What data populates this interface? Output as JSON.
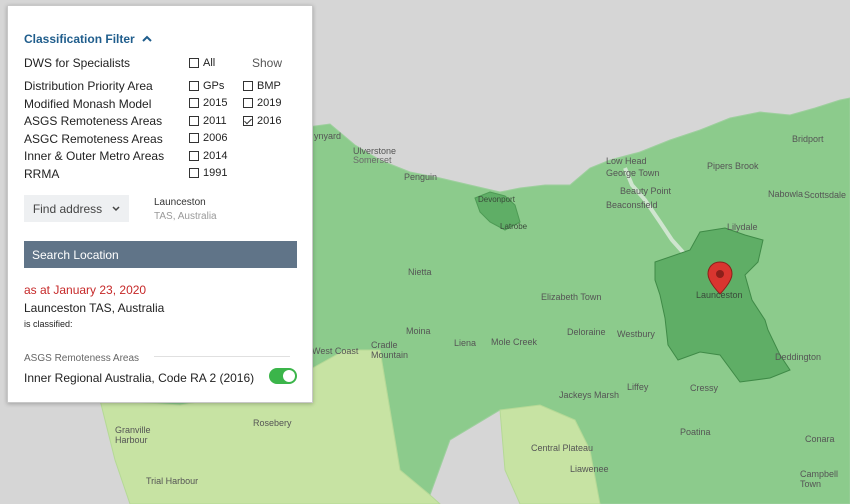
{
  "panel": {
    "title": "Classification Filter",
    "show_label": "Show",
    "filters": [
      {
        "label": "DWS for Specialists"
      },
      {
        "label": "Distribution Priority Area"
      },
      {
        "label": "Modified Monash Model"
      },
      {
        "label": "ASGS Remoteness Areas"
      },
      {
        "label": "ASGC Remoteness Areas"
      },
      {
        "label": "Inner & Outer Metro Areas"
      },
      {
        "label": "RRMA"
      }
    ],
    "checkboxes_left": [
      {
        "label": "All",
        "checked": false
      },
      {
        "label": "GPs",
        "checked": false
      },
      {
        "label": "2015",
        "checked": false
      },
      {
        "label": "2011",
        "checked": false
      },
      {
        "label": "2006",
        "checked": false
      },
      {
        "label": "2014",
        "checked": false
      },
      {
        "label": "1991",
        "checked": false
      }
    ],
    "checkboxes_right": [
      {
        "label": "BMP",
        "checked": false
      },
      {
        "label": "2019",
        "checked": false
      },
      {
        "label": "2016",
        "checked": true
      }
    ],
    "find_address_label": "Find address",
    "address_name": "Launceston",
    "address_sub": "TAS, Australia",
    "search_button": "Search Location",
    "as_at": "as at January 23, 2020",
    "location": "Launceston TAS, Australia",
    "classified_text": "is classified:",
    "section_label": "ASGS Remoteness Areas",
    "result": "Inner Regional Australia, Code RA 2 (2016)",
    "result_toggle_on": true
  },
  "map": {
    "labels": {
      "ynyard": "ynyard",
      "ulverstone": "Ulverstone",
      "somerset": "Somerset",
      "penguin": "Penguin",
      "devonport": "Devonport",
      "latrobe": "Latrobe",
      "low_head": "Low Head",
      "george_town": "George Town",
      "beauty_point": "Beauty Point",
      "beaconsfield": "Beaconsfield",
      "pipers_brook": "Pipers Brook",
      "bridport": "Bridport",
      "nabowla": "Nabowla",
      "scottsdale": "Scottsdale",
      "lilydale": "Lilydale",
      "nietta": "Nietta",
      "elizabeth_town": "Elizabeth Town",
      "launceston": "Launceston",
      "moina": "Moina",
      "liena": "Liena",
      "deloraine": "Deloraine",
      "westbury": "Westbury",
      "cradle_mountain": "Cradle Mountain",
      "mole_creek": "Mole Creek",
      "deddington": "Deddington",
      "west_coast": "West Coast",
      "liffey": "Liffey",
      "cressy": "Cressy",
      "jackeys_marsh": "Jackeys Marsh",
      "rosebery": "Rosebery",
      "granville_harbour": "Granville Harbour",
      "central_plateau": "Central Plateau",
      "poatina": "Poatina",
      "conara": "Conara",
      "liawenee": "Liawenee",
      "trial_harbour": "Trial Harbour",
      "campbell_town": "Campbell Town"
    },
    "colors": {
      "background": "#d6d6d6",
      "region_main": "#8ccb8c",
      "region_selected": "#5fae66",
      "region_remote": "#c7e3a3",
      "marker": "#d9352f"
    },
    "icons": {
      "marker": "map-pin-icon"
    }
  }
}
